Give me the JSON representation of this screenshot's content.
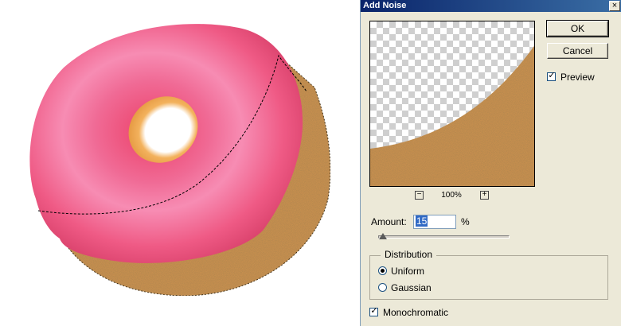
{
  "dialog": {
    "title": "Add Noise",
    "close_label": "×",
    "ok_label": "OK",
    "cancel_label": "Cancel",
    "preview_label": "Preview",
    "preview_checked": true,
    "zoom_out_label": "−",
    "zoom_in_label": "+",
    "zoom_level": "100%",
    "amount_label": "Amount:",
    "amount_value": "15",
    "amount_unit": "%",
    "amount_slider_fraction": 0.0375,
    "distribution": {
      "legend": "Distribution",
      "options": [
        {
          "label": "Uniform",
          "selected": true
        },
        {
          "label": "Gaussian",
          "selected": false
        }
      ]
    },
    "monochromatic_label": "Monochromatic",
    "monochromatic_checked": true
  },
  "colors": {
    "icing": "#ee4f79",
    "icing_highlight": "#f88bb0",
    "dough": "#c9904f",
    "dough_dark": "#a2692d",
    "hole_inner": "#f0a850",
    "titlebar_start": "#0a246a",
    "titlebar_end": "#3a6ea5",
    "dialog_bg": "#ece9d8"
  }
}
